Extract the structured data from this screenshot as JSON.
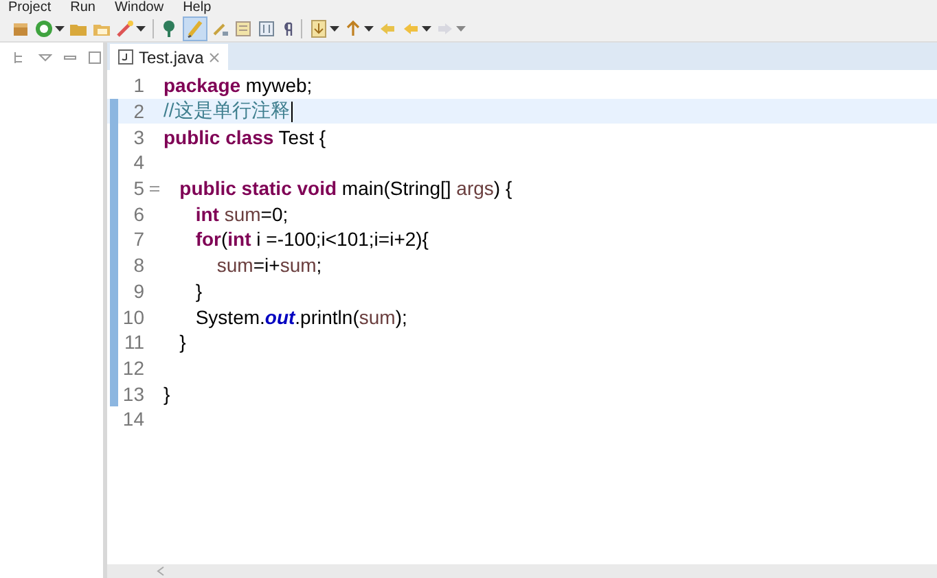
{
  "menu": [
    "Project",
    "Run",
    "Window",
    "Help"
  ],
  "toolbar": {
    "highlight_toggle_on": true
  },
  "editor_tabs": [
    {
      "label": "Test.java",
      "selected": true
    }
  ],
  "code_lines": [
    {
      "number": "1",
      "current": false,
      "changed": false,
      "fold": false,
      "tokens": [
        {
          "kind": "keyword",
          "text": "package"
        },
        {
          "kind": "plain",
          "text": " myweb;"
        }
      ]
    },
    {
      "number": "2",
      "current": true,
      "changed": true,
      "fold": false,
      "tokens": [
        {
          "kind": "comment",
          "text": "//这是单行注释"
        }
      ]
    },
    {
      "number": "3",
      "current": false,
      "changed": true,
      "fold": false,
      "tokens": [
        {
          "kind": "keyword",
          "text": "public class"
        },
        {
          "kind": "plain",
          "text": " Test {"
        }
      ]
    },
    {
      "number": "4",
      "current": false,
      "changed": true,
      "fold": false
    },
    {
      "number": "5",
      "current": false,
      "changed": true,
      "fold": true,
      "tokens": [
        {
          "kind": "keyword",
          "text": "   public static void"
        },
        {
          "kind": "plain",
          "text": " main(String[] "
        },
        {
          "kind": "variable",
          "text": "args"
        },
        {
          "kind": "plain",
          "text": ") {"
        }
      ]
    },
    {
      "number": "6",
      "current": false,
      "changed": true,
      "fold": false,
      "tokens": [
        {
          "kind": "keyword",
          "text": "      int"
        },
        {
          "kind": "variable",
          "text": " sum"
        },
        {
          "kind": "plain",
          "text": "=0;"
        }
      ]
    },
    {
      "number": "7",
      "current": false,
      "changed": true,
      "fold": false,
      "tokens": [
        {
          "kind": "keyword",
          "text": "      for"
        },
        {
          "kind": "plain",
          "text": "("
        },
        {
          "kind": "keyword",
          "text": "int"
        },
        {
          "kind": "plain",
          "text": " i =-100;i<101;i=i+2){"
        }
      ]
    },
    {
      "number": "8",
      "current": false,
      "changed": true,
      "fold": false,
      "tokens": [
        {
          "kind": "variable",
          "text": "          sum"
        },
        {
          "kind": "plain",
          "text": "=i+"
        },
        {
          "kind": "variable",
          "text": "sum"
        },
        {
          "kind": "plain",
          "text": ";"
        }
      ]
    },
    {
      "number": "9",
      "current": false,
      "changed": true,
      "fold": false,
      "tokens": [
        {
          "kind": "plain",
          "text": "      }"
        }
      ]
    },
    {
      "number": "10",
      "current": false,
      "changed": true,
      "fold": false,
      "tokens": [
        {
          "kind": "plain",
          "text": "      System."
        },
        {
          "kind": "field",
          "text": "out"
        },
        {
          "kind": "plain",
          "text": ".println("
        },
        {
          "kind": "variable",
          "text": "sum"
        },
        {
          "kind": "plain",
          "text": ");"
        }
      ]
    },
    {
      "number": "11",
      "current": false,
      "changed": true,
      "fold": false,
      "tokens": [
        {
          "kind": "plain",
          "text": "   }"
        }
      ]
    },
    {
      "number": "12",
      "current": false,
      "changed": true,
      "fold": false
    },
    {
      "number": "13",
      "current": false,
      "changed": true,
      "fold": false,
      "tokens": [
        {
          "kind": "plain",
          "text": "}"
        }
      ]
    },
    {
      "number": "14",
      "current": false,
      "changed": false,
      "fold": false
    }
  ]
}
